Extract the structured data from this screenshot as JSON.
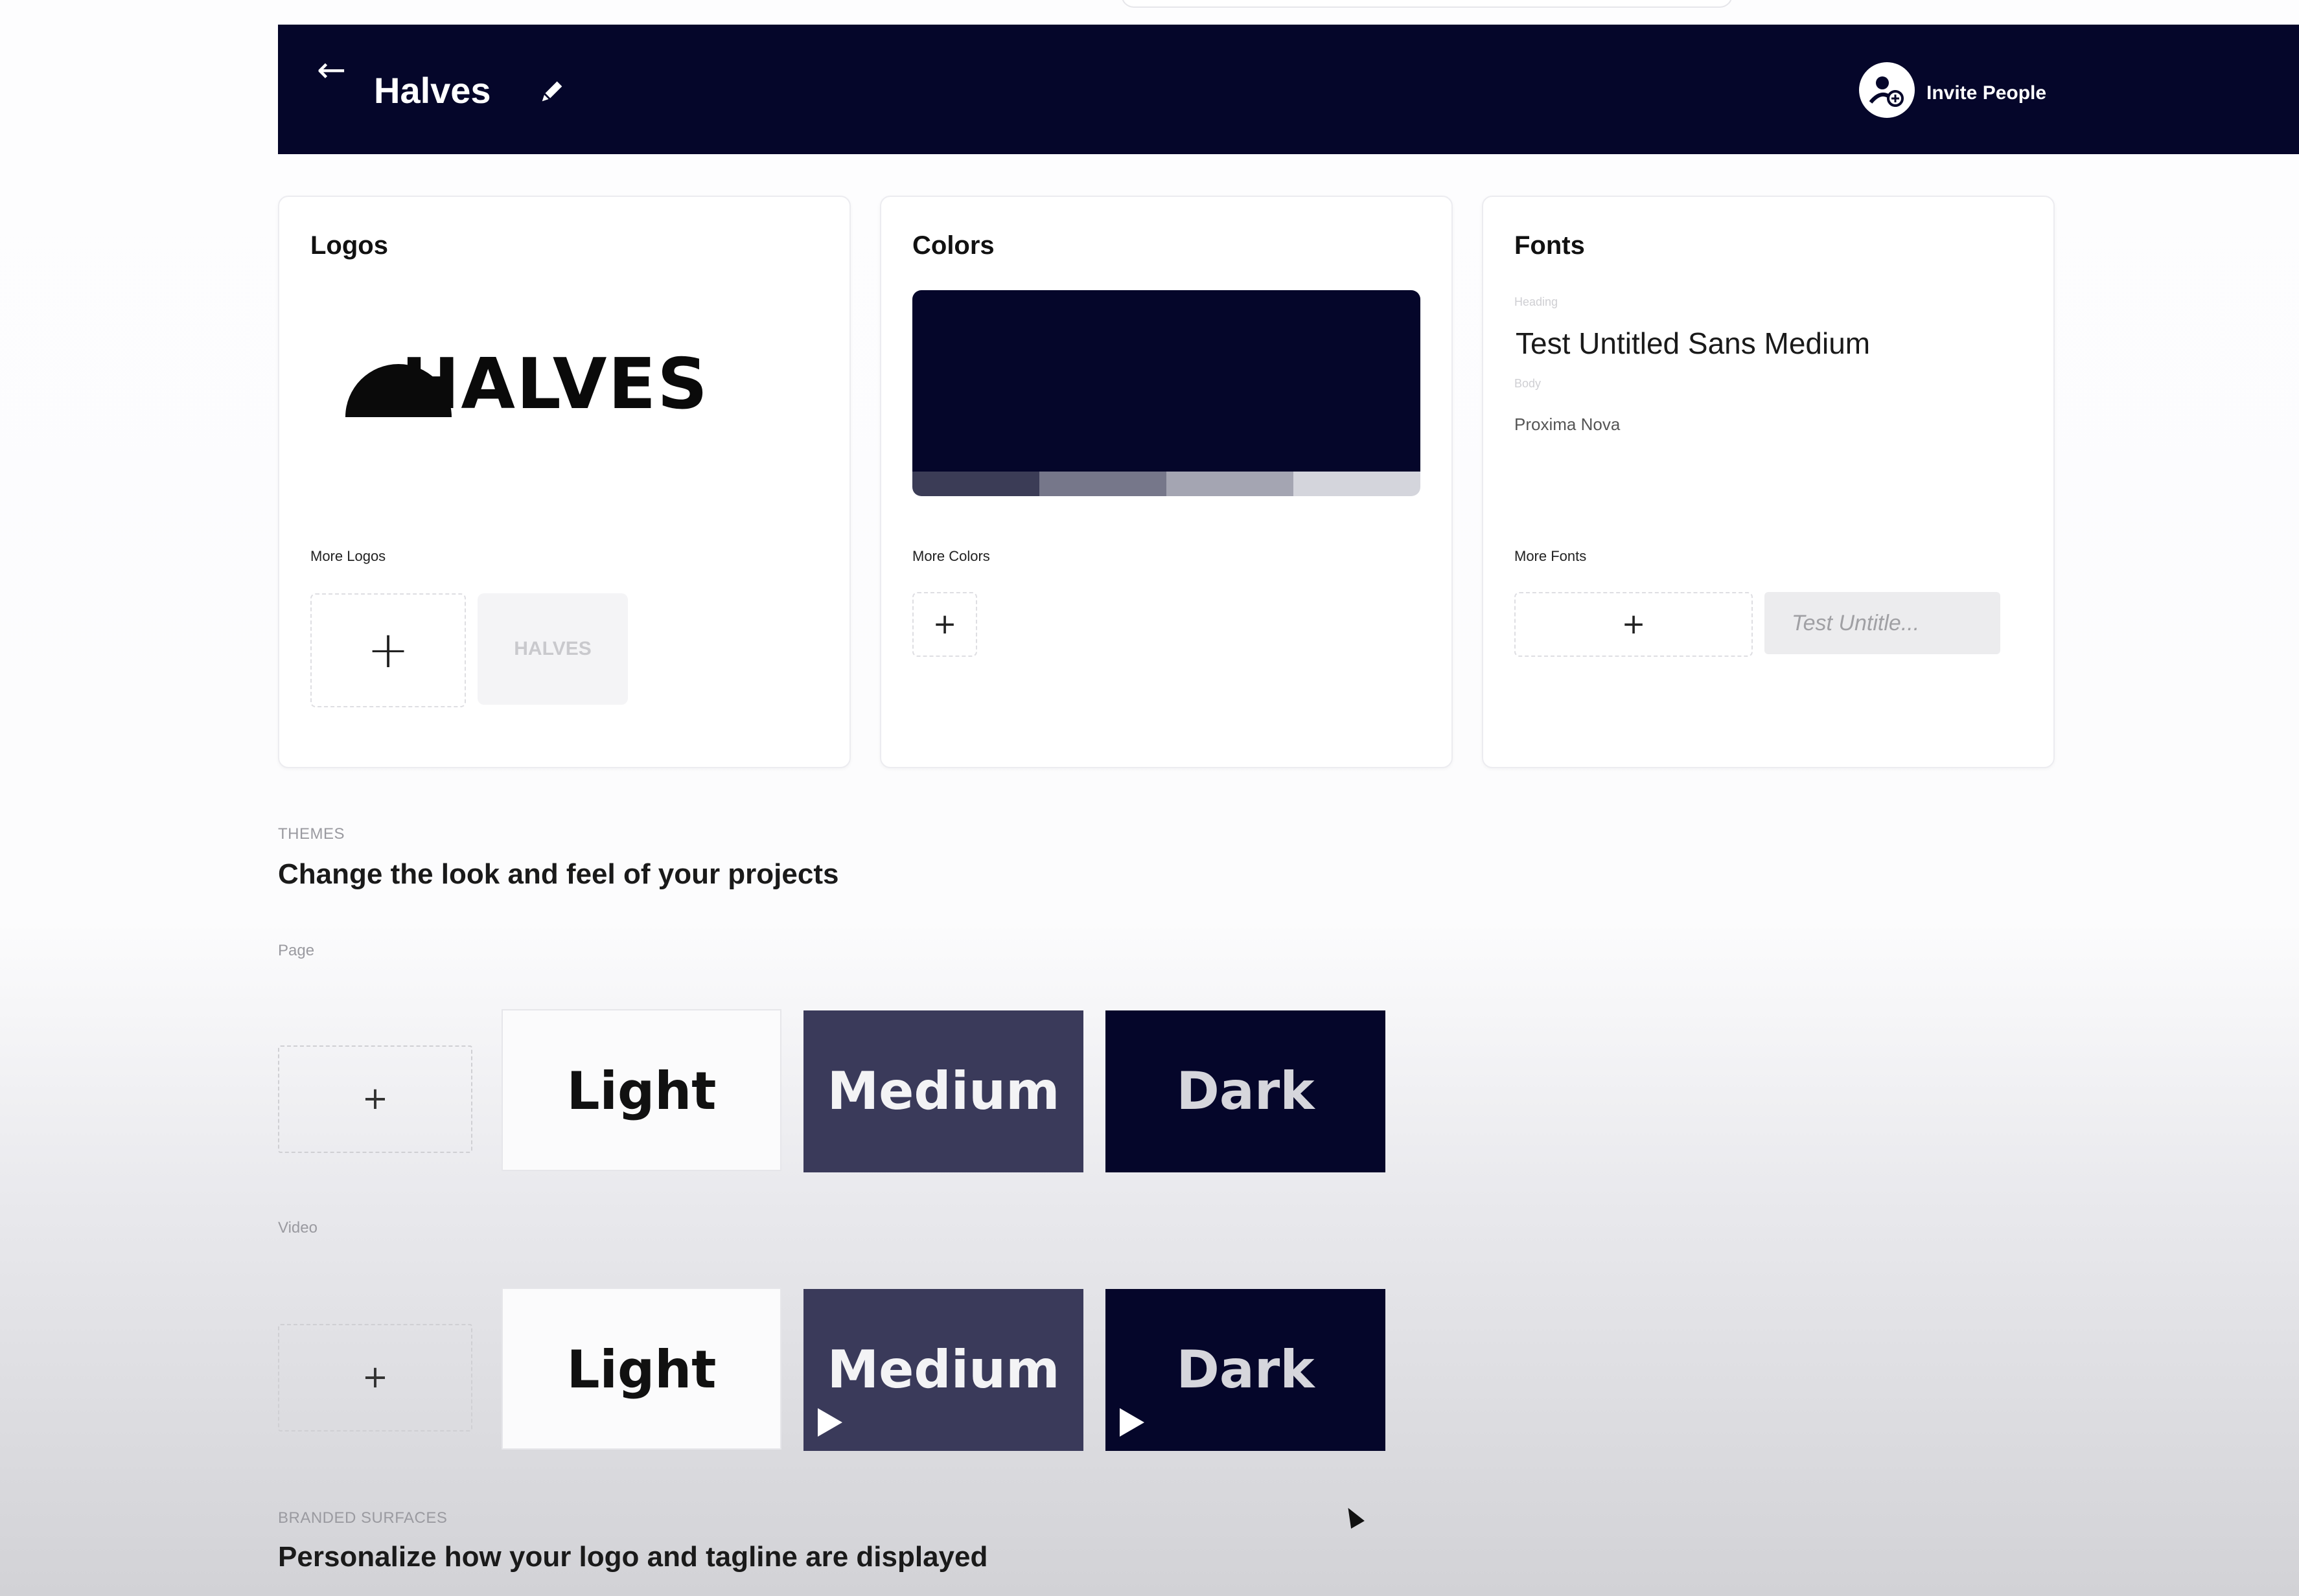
{
  "header": {
    "back_icon": "arrow-left-icon",
    "title": "Halves",
    "edit_icon": "pencil-icon",
    "invite_label": "Invite People",
    "invite_icon": "add-person-icon",
    "background_color": "#05062a"
  },
  "cards": {
    "logos": {
      "title": "Logos",
      "logo_text": "HALVES",
      "more_label": "More Logos",
      "add_icon": "plus-icon",
      "thumbnail_text": "HALVES"
    },
    "colors": {
      "title": "Colors",
      "primary_color": "#05062a",
      "palette": [
        "#3b3c56",
        "#76778a",
        "#a4a5b2",
        "#d4d5dc"
      ],
      "more_label": "More Colors",
      "add_icon": "plus-icon"
    },
    "fonts": {
      "title": "Fonts",
      "heading_label": "Heading",
      "heading_font": "Test Untitled Sans Medium",
      "body_label": "Body",
      "body_font": "Proxima Nova",
      "more_label": "More Fonts",
      "add_icon": "plus-icon",
      "thumbnail_text": "Test Untitle..."
    }
  },
  "themes": {
    "section_label": "THEMES",
    "heading": "Change the look and feel of your projects",
    "page": {
      "label": "Page",
      "options": [
        "Light",
        "Medium",
        "Dark"
      ]
    },
    "video": {
      "label": "Video",
      "options": [
        "Light",
        "Medium",
        "Dark"
      ]
    }
  },
  "branded_surfaces": {
    "section_label": "BRANDED SURFACES",
    "heading": "Personalize how your logo and tagline are displayed"
  }
}
